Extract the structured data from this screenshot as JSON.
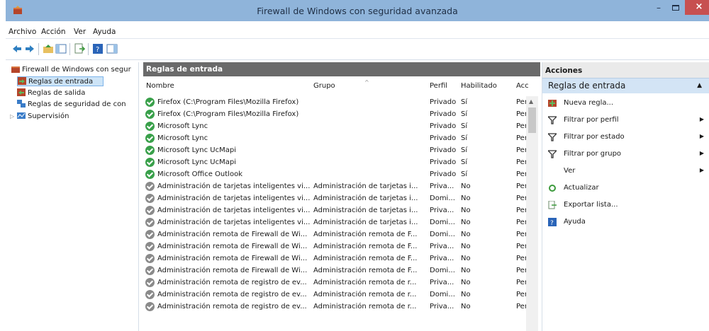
{
  "window": {
    "title": "Firewall de Windows con seguridad avanzada",
    "min": "–",
    "close": "×"
  },
  "menu": [
    "Archivo",
    "Acción",
    "Ver",
    "Ayuda"
  ],
  "tree": {
    "root": "Firewall de Windows con segur",
    "items": [
      "Reglas de entrada",
      "Reglas de salida",
      "Reglas de seguridad de con",
      "Supervisión"
    ]
  },
  "center": {
    "header": "Reglas de entrada",
    "columns": [
      "Nombre",
      "Grupo",
      "Perfil",
      "Habilitado",
      "Acc"
    ],
    "rows": [
      {
        "name": "Firefox (C:\\Program Files\\Mozilla Firefox)",
        "group": "",
        "profile": "Privado",
        "enabled": "Sí",
        "action": "Per",
        "on": true
      },
      {
        "name": "Firefox (C:\\Program Files\\Mozilla Firefox)",
        "group": "",
        "profile": "Privado",
        "enabled": "Sí",
        "action": "Per",
        "on": true
      },
      {
        "name": "Microsoft Lync",
        "group": "",
        "profile": "Privado",
        "enabled": "Sí",
        "action": "Per",
        "on": true
      },
      {
        "name": "Microsoft Lync",
        "group": "",
        "profile": "Privado",
        "enabled": "Sí",
        "action": "Per",
        "on": true
      },
      {
        "name": "Microsoft Lync UcMapi",
        "group": "",
        "profile": "Privado",
        "enabled": "Sí",
        "action": "Per",
        "on": true
      },
      {
        "name": "Microsoft Lync UcMapi",
        "group": "",
        "profile": "Privado",
        "enabled": "Sí",
        "action": "Per",
        "on": true
      },
      {
        "name": "Microsoft Office Outlook",
        "group": "",
        "profile": "Privado",
        "enabled": "Sí",
        "action": "Per",
        "on": true
      },
      {
        "name": "Administración de tarjetas inteligentes vi...",
        "group": "Administración de tarjetas i...",
        "profile": "Priva...",
        "enabled": "No",
        "action": "Per",
        "on": false
      },
      {
        "name": "Administración de tarjetas inteligentes vi...",
        "group": "Administración de tarjetas i...",
        "profile": "Domi...",
        "enabled": "No",
        "action": "Per",
        "on": false
      },
      {
        "name": "Administración de tarjetas inteligentes vi...",
        "group": "Administración de tarjetas i...",
        "profile": "Priva...",
        "enabled": "No",
        "action": "Per",
        "on": false
      },
      {
        "name": "Administración de tarjetas inteligentes vi...",
        "group": "Administración de tarjetas i...",
        "profile": "Domi...",
        "enabled": "No",
        "action": "Per",
        "on": false
      },
      {
        "name": "Administración remota de Firewall de Wi...",
        "group": "Administración remota de F...",
        "profile": "Domi...",
        "enabled": "No",
        "action": "Per",
        "on": false
      },
      {
        "name": "Administración remota de Firewall de Wi...",
        "group": "Administración remota de F...",
        "profile": "Priva...",
        "enabled": "No",
        "action": "Per",
        "on": false
      },
      {
        "name": "Administración remota de Firewall de Wi...",
        "group": "Administración remota de F...",
        "profile": "Priva...",
        "enabled": "No",
        "action": "Per",
        "on": false
      },
      {
        "name": "Administración remota de Firewall de Wi...",
        "group": "Administración remota de F...",
        "profile": "Domi...",
        "enabled": "No",
        "action": "Per",
        "on": false
      },
      {
        "name": "Administración remota de registro de ev...",
        "group": "Administración remota de r...",
        "profile": "Priva...",
        "enabled": "No",
        "action": "Per",
        "on": false
      },
      {
        "name": "Administración remota de registro de ev...",
        "group": "Administración remota de r...",
        "profile": "Domi...",
        "enabled": "No",
        "action": "Per",
        "on": false
      },
      {
        "name": "Administración remota de registro de ev...",
        "group": "Administración remota de r...",
        "profile": "Priva...",
        "enabled": "No",
        "action": "Per",
        "on": false
      }
    ]
  },
  "actions": {
    "title": "Acciones",
    "section": "Reglas de entrada",
    "items": [
      {
        "label": "Nueva regla...",
        "icon": "new-rule-icon",
        "sub": false
      },
      {
        "label": "Filtrar por perfil",
        "icon": "filter-icon",
        "sub": true
      },
      {
        "label": "Filtrar por estado",
        "icon": "filter-icon",
        "sub": true
      },
      {
        "label": "Filtrar por grupo",
        "icon": "filter-icon",
        "sub": true
      },
      {
        "label": "Ver",
        "icon": "",
        "sub": true
      },
      {
        "label": "Actualizar",
        "icon": "refresh-icon",
        "sub": false
      },
      {
        "label": "Exportar lista...",
        "icon": "export-icon",
        "sub": false
      },
      {
        "label": "Ayuda",
        "icon": "help-icon",
        "sub": false
      }
    ]
  },
  "colors": {
    "titlebar": "#8fb4da",
    "close": "#c75050",
    "section": "#d3e4f5",
    "enabled": "#39a04a",
    "disabled": "#8a8a8a"
  }
}
